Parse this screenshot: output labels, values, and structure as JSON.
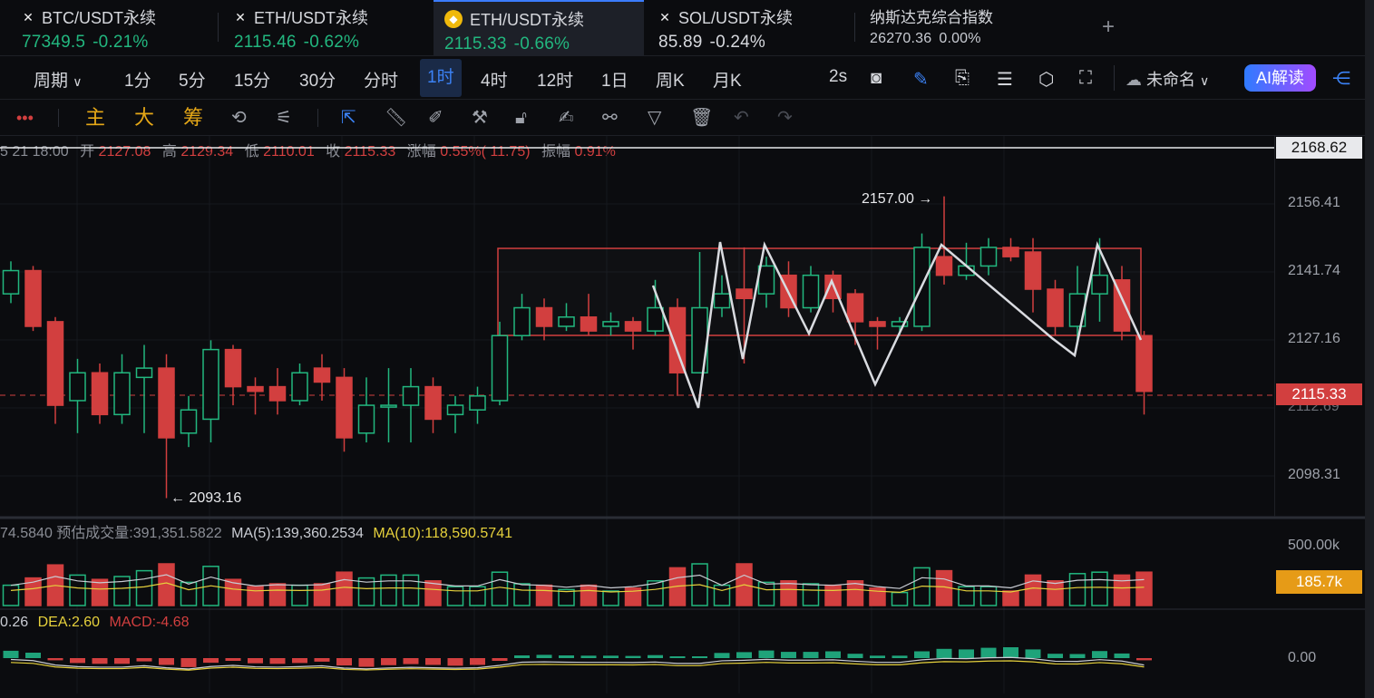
{
  "tabs": [
    {
      "name": "BTC/USDT永续",
      "price": "77349.5",
      "change": "-0.21%",
      "icon": "x-logo-icon"
    },
    {
      "name": "ETH/USDT永续",
      "price": "2115.46",
      "change": "-0.62%",
      "icon": "x-logo-icon"
    },
    {
      "name": "ETH/USDT永续",
      "price": "2115.33",
      "change": "-0.66%",
      "icon": "binance-coin-icon",
      "active": true
    },
    {
      "name": "SOL/USDT永续",
      "price": "85.89",
      "change": "-0.24%",
      "icon": "x-logo-icon"
    },
    {
      "name": "纳斯达克综合指数",
      "price": "26270.36",
      "change": "0.00%"
    }
  ],
  "add_tab": "+",
  "toolbar": {
    "period": "周期",
    "intervals": [
      "1分",
      "5分",
      "15分",
      "30分",
      "分时",
      "1时",
      "4时",
      "12时",
      "1日",
      "周K",
      "月K"
    ],
    "selected": "1时",
    "refresh": "2s",
    "layout_name": "未命名",
    "ai_label": "AI解读"
  },
  "draw_toolbar": {
    "main_label": "主",
    "big_label": "大",
    "chip_label": "筹"
  },
  "ohlc": {
    "time": "5 21 18:00",
    "open_label": "开",
    "open": "2127.08",
    "high_label": "高",
    "high": "2129.34",
    "low_label": "低",
    "low": "2110.01",
    "close_label": "收",
    "close": "2115.33",
    "chg_label": "涨幅",
    "chg": "0.55%( 11.75)",
    "amp_label": "振幅",
    "amp": "0.91%"
  },
  "price_axis": {
    "ticks": [
      "2156.41",
      "2141.74",
      "2127.16",
      "2098.31"
    ],
    "top_line": "2168.62",
    "current": "2115.33",
    "partial": "2112.69"
  },
  "annotations": {
    "high": "2157.00",
    "low": "2093.16"
  },
  "volume": {
    "cut_value": "74.5840",
    "est_label": "预估成交量:391,351.5822",
    "ma5": "MA(5):139,360.2534",
    "ma10": "MA(10):118,590.5741",
    "axis_top": "500.00k",
    "current": "185.7k"
  },
  "macd": {
    "dif": "0.26",
    "dea": "DEA:2.60",
    "macd": "MACD:-4.68",
    "axis_zero": "0.00"
  },
  "colors": {
    "up": "#22b77f",
    "down": "#d23f3f",
    "accent": "#3b82f6",
    "gold": "#e6a817"
  },
  "chart_data": {
    "type": "candlestick",
    "y_range": [
      2088,
      2170
    ],
    "candles": [
      [
        2136,
        2141,
        2134,
        2143
      ],
      [
        2141,
        2129,
        2128,
        2142
      ],
      [
        2130,
        2112,
        2108,
        2131
      ],
      [
        2113,
        2119,
        2106,
        2122
      ],
      [
        2119,
        2110,
        2108,
        2121
      ],
      [
        2110,
        2119,
        2108,
        2123
      ],
      [
        2118,
        2120,
        2106,
        2125
      ],
      [
        2120,
        2105,
        2092,
        2123
      ],
      [
        2106,
        2111,
        2103,
        2114
      ],
      [
        2109,
        2124,
        2104,
        2126
      ],
      [
        2124,
        2116,
        2112,
        2125
      ],
      [
        2116,
        2115,
        2110,
        2118
      ],
      [
        2116,
        2113,
        2110,
        2120
      ],
      [
        2113,
        2119,
        2112,
        2121
      ],
      [
        2120,
        2117,
        2113,
        2123
      ],
      [
        2118,
        2105,
        2102,
        2120
      ],
      [
        2106,
        2112,
        2104,
        2118
      ],
      [
        2112,
        2112,
        2104,
        2120
      ],
      [
        2112,
        2116,
        2104,
        2120
      ],
      [
        2116,
        2109,
        2106,
        2118
      ],
      [
        2110,
        2112,
        2106,
        2114
      ],
      [
        2111,
        2114,
        2108,
        2116
      ],
      [
        2113,
        2127,
        2112,
        2130
      ],
      [
        2127,
        2133,
        2126,
        2136
      ],
      [
        2133,
        2129,
        2126,
        2135
      ],
      [
        2129,
        2131,
        2128,
        2134
      ],
      [
        2131,
        2128,
        2127,
        2136
      ],
      [
        2129,
        2130,
        2127,
        2132
      ],
      [
        2130,
        2128,
        2124,
        2131
      ],
      [
        2128,
        2133,
        2127,
        2139
      ],
      [
        2133,
        2119,
        2114,
        2135
      ],
      [
        2119,
        2133,
        2120,
        2145
      ],
      [
        2133,
        2136,
        2131,
        2140
      ],
      [
        2137,
        2135,
        2121,
        2146
      ],
      [
        2136,
        2142,
        2133,
        2144
      ],
      [
        2140,
        2133,
        2131,
        2143
      ],
      [
        2133,
        2140,
        2132,
        2142
      ],
      [
        2140,
        2135,
        2132,
        2141
      ],
      [
        2136,
        2130,
        2125,
        2137
      ],
      [
        2130,
        2129,
        2124,
        2131
      ],
      [
        2129,
        2130,
        2127,
        2131
      ],
      [
        2129,
        2146,
        2128,
        2149
      ],
      [
        2144,
        2140,
        2138,
        2157
      ],
      [
        2140,
        2142,
        2139,
        2147
      ],
      [
        2142,
        2146,
        2140,
        2148
      ],
      [
        2146,
        2144,
        2143,
        2148
      ],
      [
        2145,
        2137,
        2132,
        2148
      ],
      [
        2137,
        2129,
        2127,
        2139
      ],
      [
        2129,
        2136,
        2125,
        2142
      ],
      [
        2136,
        2140,
        2130,
        2148
      ],
      [
        2139,
        2128,
        2126,
        2142
      ],
      [
        2127,
        2115,
        2110,
        2128
      ]
    ],
    "volume_ma_max": "500.00k"
  }
}
